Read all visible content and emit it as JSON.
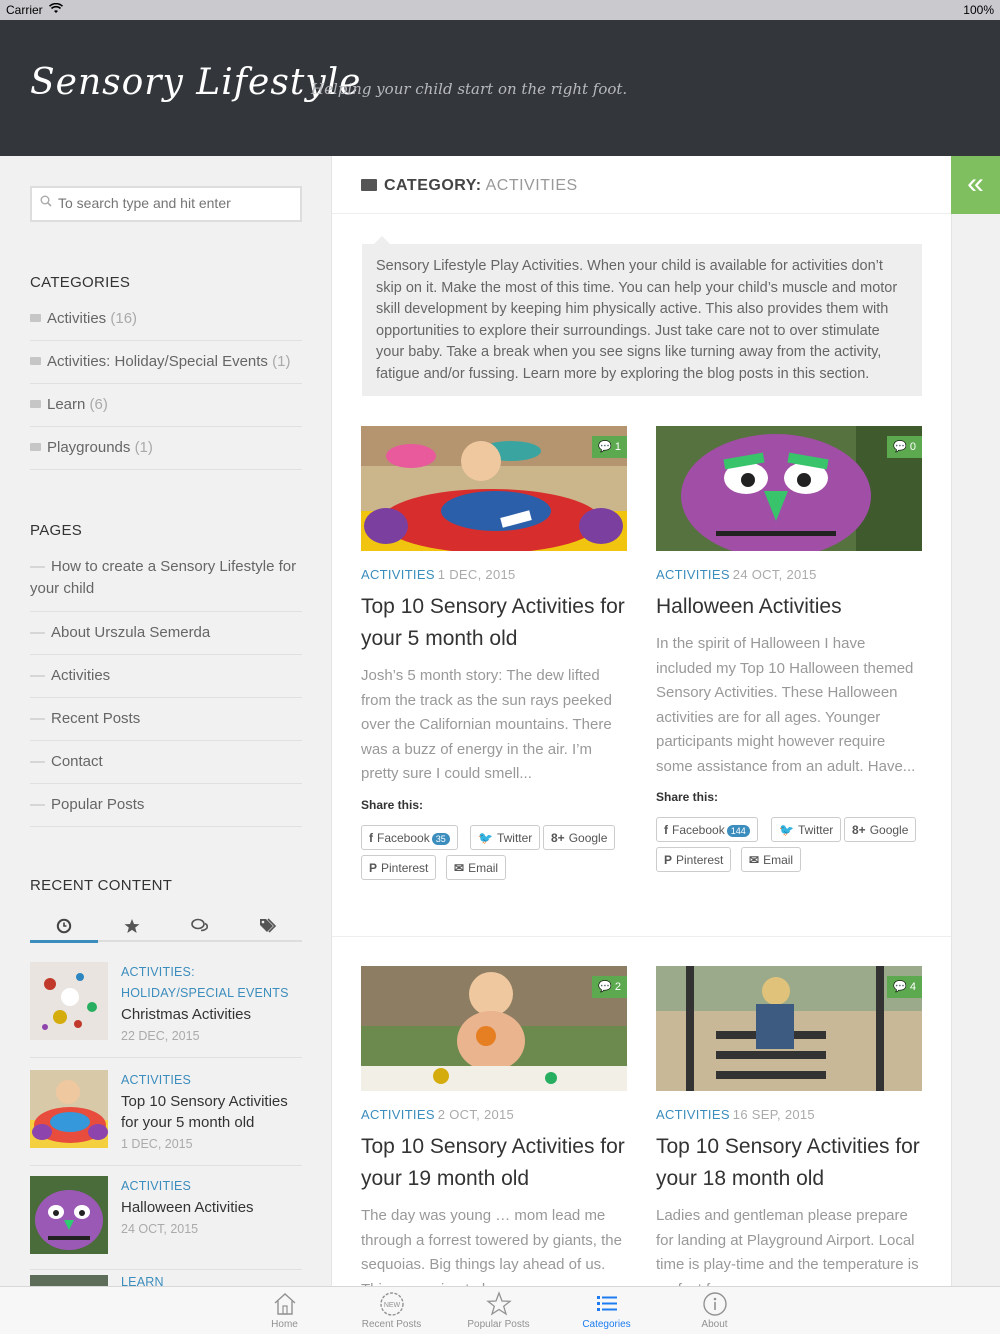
{
  "status_bar": {
    "carrier": "Carrier",
    "battery": "100%"
  },
  "header": {
    "logo": "Sensory Lifestyle",
    "tagline": "Helping your child start on the right foot."
  },
  "sidebar": {
    "search_placeholder": "To search type and hit enter",
    "categories_heading": "CATEGORIES",
    "categories": [
      {
        "label": "Activities",
        "count": "(16)"
      },
      {
        "label": "Activities: Holiday/Special Events",
        "count": "(1)"
      },
      {
        "label": "Learn",
        "count": "(6)"
      },
      {
        "label": "Playgrounds",
        "count": "(1)"
      }
    ],
    "pages_heading": "PAGES",
    "pages": [
      "How to create a Sensory Lifestyle for your child",
      "About Urszula Semerda",
      "Activities",
      "Recent Posts",
      "Contact",
      "Popular Posts"
    ],
    "recent_heading": "RECENT CONTENT",
    "recent_tabs": [
      "clock-icon",
      "star-icon",
      "comments-icon",
      "tags-icon"
    ],
    "recent_items": [
      {
        "category": "ACTIVITIES: HOLIDAY/SPECIAL EVENTS",
        "title": "Christmas Activities",
        "date": "22 DEC, 2015"
      },
      {
        "category": "ACTIVITIES",
        "title": "Top 10 Sensory Activities for your 5 month old",
        "date": "1 DEC, 2015"
      },
      {
        "category": "ACTIVITIES",
        "title": "Halloween Activities",
        "date": "24 OCT, 2015"
      },
      {
        "category": "LEARN",
        "title": "",
        "date": ""
      }
    ]
  },
  "main": {
    "category_label": "CATEGORY:",
    "category_value": "ACTIVITIES",
    "description": "Sensory Lifestyle Play Activities. When your child is available for activities don’t skip on it. Make the most of this time. You can help your child’s muscle and motor skill development by keeping him physically active. This also provides them with opportunities to explore their surroundings. Just take care not to over stimulate your baby. Take a break when you see signs like turning away from the activity, fatigue and/or fussing. Learn more by exploring the blog posts in this section.",
    "share_label": "Share this:",
    "posts": [
      {
        "comments": "1",
        "category": "ACTIVITIES",
        "date": "1 DEC, 2015",
        "title": "Top 10 Sensory Activities for your 5 month old",
        "excerpt": "Josh’s 5 month story: The dew lifted from the track as the sun rays peeked over the Californian mountains. There was a buzz of energy in the air. I’m pretty sure I could smell...",
        "facebook_count": "35"
      },
      {
        "comments": "0",
        "category": "ACTIVITIES",
        "date": "24 OCT, 2015",
        "title": "Halloween Activities",
        "excerpt": " In the spirit of Halloween I have included my Top 10 Halloween themed Sensory Activities. These Halloween activities are for all ages. Younger participants might however require some assistance from an adult. Have...",
        "facebook_count": "144"
      },
      {
        "comments": "2",
        "category": "ACTIVITIES",
        "date": "2 OCT, 2015",
        "title": "Top 10 Sensory Activities for your 19 month old",
        "excerpt": "The day was young … mom lead me through a forrest towered by giants, the sequoias. Big things lay ahead of us. This was going to be..."
      },
      {
        "comments": "4",
        "category": "ACTIVITIES",
        "date": "16 SEP, 2015",
        "title": "Top 10 Sensory Activities for your 18 month old",
        "excerpt": "Ladies and gentleman please prepare for landing at Playground Airport. Local time is play-time and the temperature is perfect for..."
      }
    ],
    "share_buttons": {
      "facebook": "Facebook",
      "twitter": "Twitter",
      "google": "Google",
      "pinterest": "Pinterest",
      "email": "Email"
    }
  },
  "tabbar": [
    {
      "label": "Home",
      "icon": "home-icon"
    },
    {
      "label": "Recent Posts",
      "icon": "new-badge-icon"
    },
    {
      "label": "Popular Posts",
      "icon": "star-icon"
    },
    {
      "label": "Categories",
      "icon": "list-icon",
      "active": true
    },
    {
      "label": "About",
      "icon": "info-icon"
    }
  ],
  "colors": {
    "accent": "#3b8dbd",
    "green": "#5ca94f",
    "header_bg": "#33363b",
    "tab_active": "#1e7cf0"
  }
}
